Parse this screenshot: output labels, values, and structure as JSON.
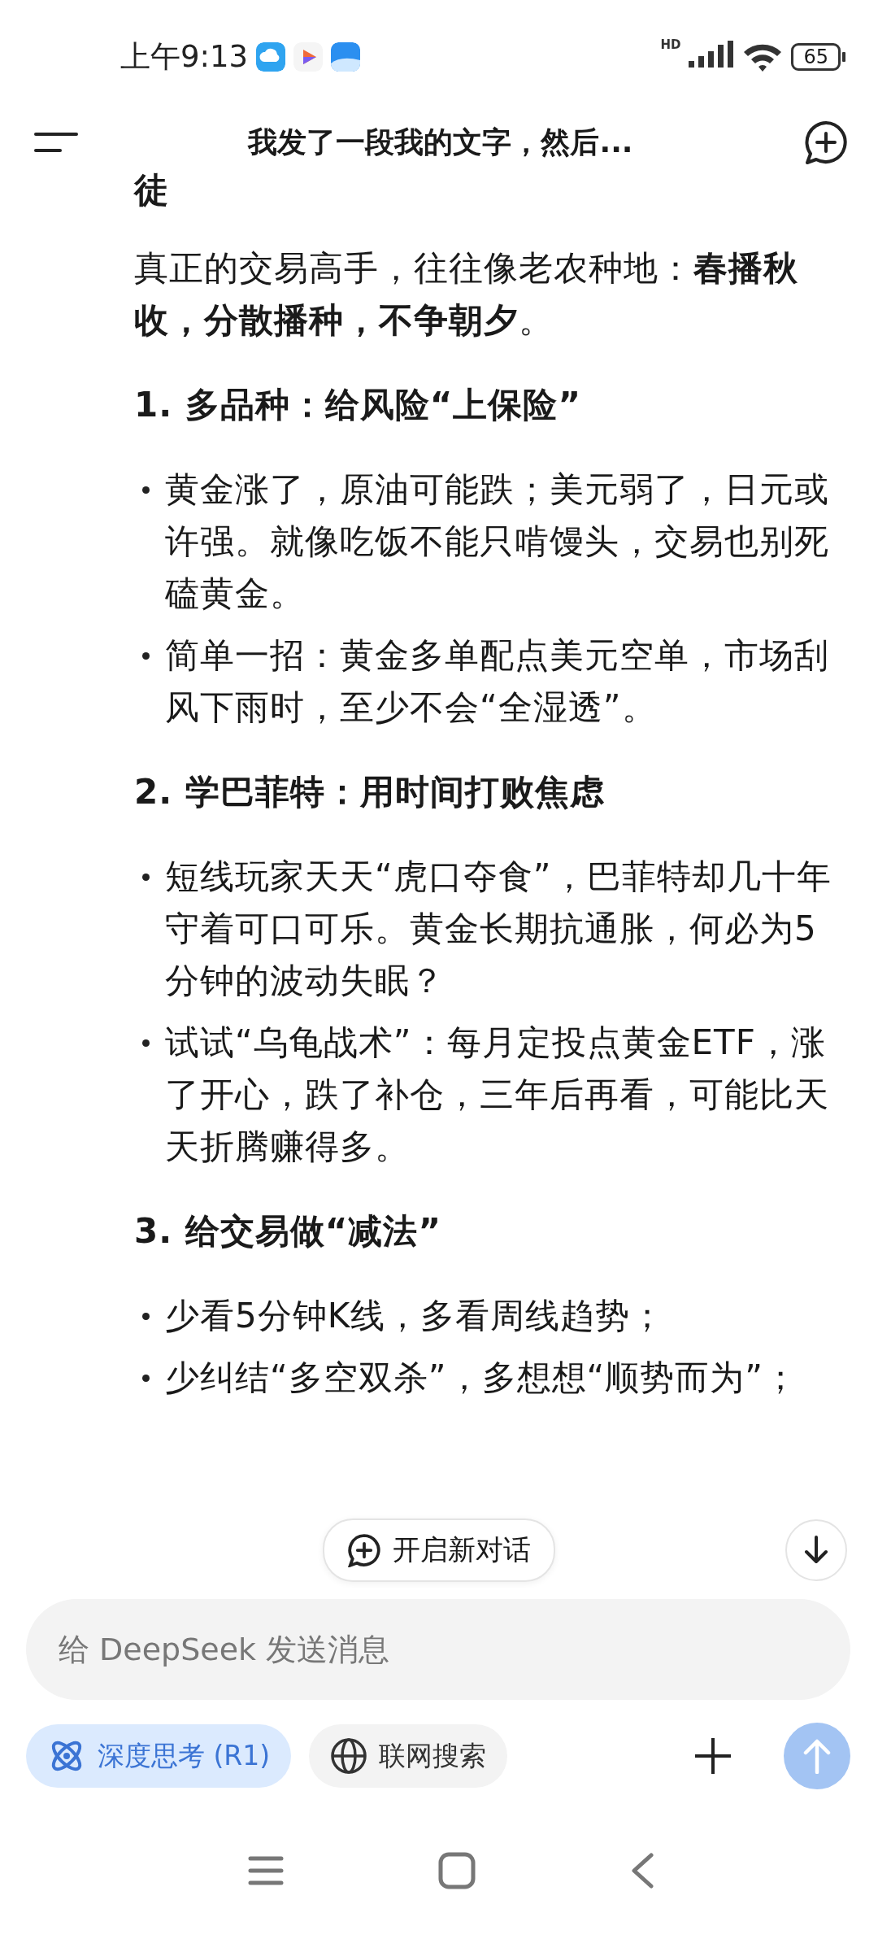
{
  "status_bar": {
    "time": "上午9:13",
    "network": "HD",
    "battery": "65"
  },
  "header": {
    "title": "我发了一段我的文字，然后..."
  },
  "message": {
    "blocks": [
      {
        "kind": "fragment",
        "text": "徒"
      },
      {
        "kind": "paragraph",
        "text": "真正的交易高手，往往像老农种地：**春播秋收，分散播种，不争朝夕**。"
      },
      {
        "kind": "heading",
        "text": "1. 多品种：给风险“上保险”"
      },
      {
        "kind": "list",
        "items": [
          "黄金涨了，原油可能跌；美元弱了，日元或许强。就像吃饭不能只啃馒头，交易也别死磕黄金。",
          "简单一招：黄金多单配点美元空单，市场刮风下雨时，至少不会“全湿透”。"
        ]
      },
      {
        "kind": "heading",
        "text": "2. 学巴菲特：用时间打败焦虑"
      },
      {
        "kind": "list",
        "items": [
          "短线玩家天天“虎口夺食”，巴菲特却几十年守着可口可乐。黄金长期抗通胀，何必为5分钟的波动失眠？",
          "试试“乌龟战术”：每月定投点黄金ETF，涨了开心，跌了补仓，三年后再看，可能比天天折腾赚得多。"
        ]
      },
      {
        "kind": "heading",
        "text": "3. 给交易做“减法”"
      },
      {
        "kind": "list",
        "items": [
          "少看5分钟K线，多看周线趋势；",
          "少纠结“多空双杀”，多想想“顺势而为”；"
        ]
      }
    ]
  },
  "new_chat_button": {
    "label": "开启新对话"
  },
  "composer": {
    "placeholder": "给 DeepSeek 发送消息",
    "toggles": [
      {
        "kind": "think",
        "label": "深度思考 (R1)",
        "selected": true
      },
      {
        "kind": "web",
        "label": "联网搜索",
        "selected": false
      }
    ]
  }
}
